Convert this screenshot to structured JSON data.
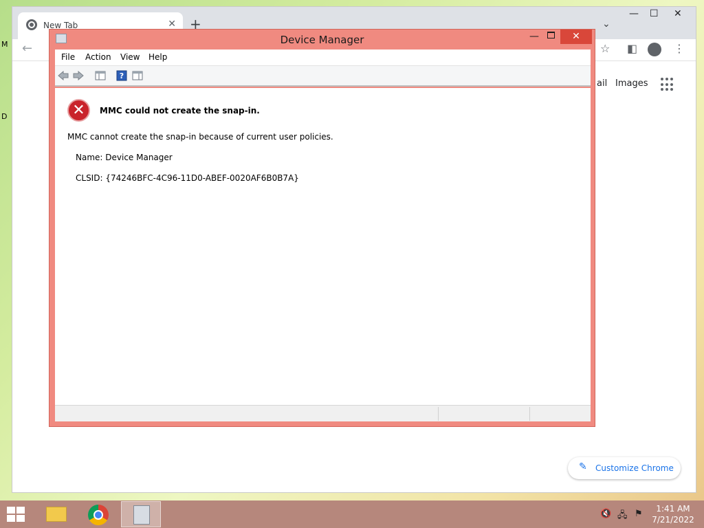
{
  "chrome": {
    "tab_title": "New Tab",
    "tab_close": "✕",
    "new_tab": "+",
    "tab_search": "⌄",
    "win_min": "—",
    "win_max": "☐",
    "win_close": "✕",
    "back": "←",
    "star": "☆",
    "sidebar": "◧",
    "menu": "⋮",
    "gmail": "ail",
    "images": "Images",
    "customize_label": "Customize Chrome",
    "customize_icon": "✎",
    "edge_m": "M",
    "edge_d": "D"
  },
  "mmc": {
    "title": "Device Manager",
    "min": "—",
    "close": "✕",
    "menu": [
      "File",
      "Action",
      "View",
      "Help"
    ],
    "error_heading": "MMC could not create the snap-in.",
    "error_message": "MMC cannot create the snap-in because of current user policies.",
    "name_line": "Name: Device Manager",
    "clsid_line": "CLSID: {74246BFC-4C96-11D0-ABEF-0020AF6B0B7A}",
    "error_glyph": "✕"
  },
  "taskbar": {
    "time": "1:41 AM",
    "date": "7/21/2022",
    "tray_volume": "🔇",
    "tray_network": "🖧",
    "tray_flag": "⚑"
  },
  "colors": {
    "window_frame": "#f08a80",
    "close_button": "#d9473a",
    "taskbar": "#b6877c",
    "chrome_link": "#1a73e8"
  }
}
